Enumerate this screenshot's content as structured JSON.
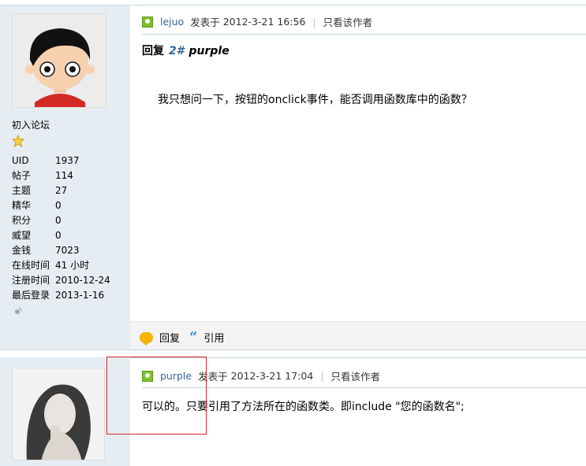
{
  "post1": {
    "author": "lejuo",
    "posted_prefix": "发表于",
    "timestamp": "2012-3-21 16:56",
    "only_author_label": "只看该作者",
    "reply_prefix": "回复",
    "floor": "2#",
    "reply_to": "purple",
    "body": "我只想问一下，按钮的onclick事件，能否调用函数库中的函数？",
    "user_title": "初入论坛",
    "stats": [
      {
        "label": "UID",
        "value": "1937"
      },
      {
        "label": "帖子",
        "value": "114"
      },
      {
        "label": "主题",
        "value": "27"
      },
      {
        "label": "精华",
        "value": "0"
      },
      {
        "label": "积分",
        "value": "0"
      },
      {
        "label": "威望",
        "value": "0"
      },
      {
        "label": "金钱",
        "value": "7023"
      },
      {
        "label": "在线时间",
        "value": "41 小时"
      },
      {
        "label": "注册时间",
        "value": "2010-12-24"
      },
      {
        "label": "最后登录",
        "value": "2013-1-16"
      }
    ],
    "actions": {
      "reply": "回复",
      "quote": "引用"
    }
  },
  "post2": {
    "author": "purple",
    "posted_prefix": "发表于",
    "timestamp": "2012-3-21 17:04",
    "only_author_label": "只看该作者",
    "body": "可以的。只要引用了方法所在的函数类。即include \"您的函数名\";"
  },
  "colors": {
    "sidebar_bg": "#e5edf2",
    "link": "#336699",
    "highlight_box": "#d9232a"
  }
}
